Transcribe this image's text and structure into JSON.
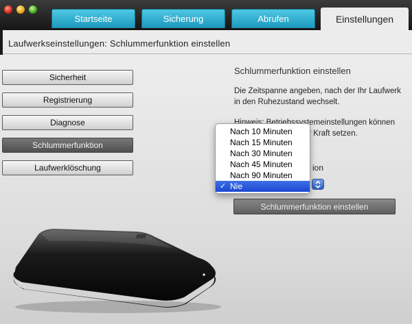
{
  "window": {
    "controls": {
      "close": "close",
      "minimize": "minimize",
      "zoom": "zoom"
    }
  },
  "tabs": [
    {
      "label": "Startseite"
    },
    {
      "label": "Sicherung"
    },
    {
      "label": "Abrufen"
    },
    {
      "label": "Einstellungen"
    }
  ],
  "header": {
    "title": "Laufwerkseinstellungen: Schlummerfunktion einstellen"
  },
  "sidebar": {
    "items": [
      {
        "label": "Sicherheit"
      },
      {
        "label": "Registrierung"
      },
      {
        "label": "Diagnose"
      },
      {
        "label": "Schlummerfunktion",
        "active": true
      },
      {
        "label": "Laufwerklöschung"
      }
    ]
  },
  "panel": {
    "title": "Schlummerfunktion einstellen",
    "description_line1": "Die Zeitspanne angeben, nach der Ihr Laufwerk",
    "description_line2": "in den Ruhezustand wechselt.",
    "hint_line1": "Hinweis: Betriebssystemeinstellungen können",
    "hint_line2": "außer Kraft setzen.",
    "field_label": "ion",
    "action_button": "Schlummerfunktion einstellen"
  },
  "dropdown": {
    "options": [
      "Nach 10 Minuten",
      "Nach 15 Minuten",
      "Nach 30 Minuten",
      "Nach 45 Minuten",
      "Nach 90 Minuten",
      "Nie"
    ],
    "selected": "Nie",
    "check_mark": "✓"
  },
  "colors": {
    "tab_blue": "#1c98bd",
    "selection_blue": "#1a48d2",
    "active_nav": "#4f4f4f"
  },
  "icons": {
    "select_arrows": "updown-chevron-icon",
    "drive": "external-hard-drive-image"
  }
}
